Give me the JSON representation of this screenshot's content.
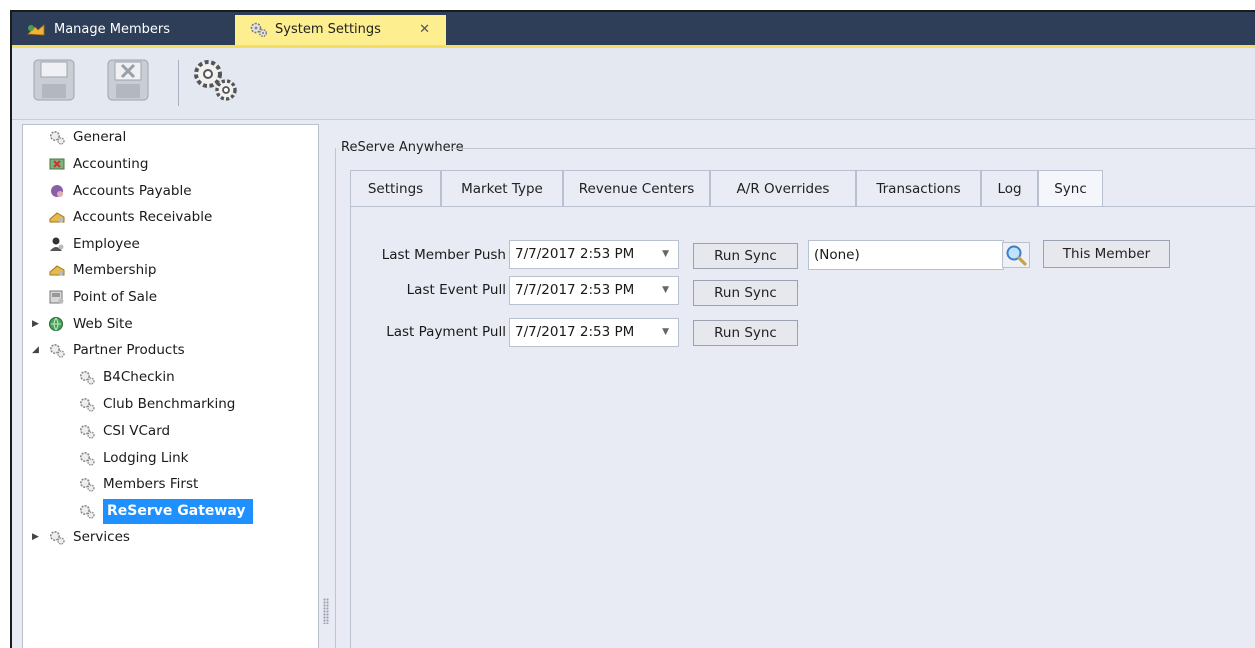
{
  "tabs": [
    {
      "label": "Manage Members",
      "active": false
    },
    {
      "label": "System Settings",
      "active": true,
      "close": "✕"
    }
  ],
  "toolbar": {
    "icons": [
      "save-icon",
      "cancel-save-icon",
      "settings-gears-icon"
    ]
  },
  "tree": {
    "items": [
      {
        "label": "General",
        "icon": "gears-icon",
        "level": 0
      },
      {
        "label": "Accounting",
        "icon": "accounting-icon",
        "level": 0
      },
      {
        "label": "Accounts Payable",
        "icon": "accounts-payable-icon",
        "level": 0
      },
      {
        "label": "Accounts Receivable",
        "icon": "accounts-receivable-icon",
        "level": 0
      },
      {
        "label": "Employee",
        "icon": "employee-icon",
        "level": 0
      },
      {
        "label": "Membership",
        "icon": "membership-icon",
        "level": 0
      },
      {
        "label": "Point of Sale",
        "icon": "pos-icon",
        "level": 0
      },
      {
        "label": "Web Site",
        "icon": "globe-icon",
        "level": 0,
        "expander": "collapsed"
      },
      {
        "label": "Partner Products",
        "icon": "gears-icon",
        "level": 0,
        "expander": "expanded"
      },
      {
        "label": "B4Checkin",
        "icon": "gears-icon",
        "level": 1
      },
      {
        "label": "Club Benchmarking",
        "icon": "gears-icon",
        "level": 1
      },
      {
        "label": "CSI VCard",
        "icon": "gears-icon",
        "level": 1
      },
      {
        "label": "Lodging Link",
        "icon": "gears-icon",
        "level": 1
      },
      {
        "label": "Members First",
        "icon": "gears-icon",
        "level": 1
      },
      {
        "label": "ReServe Gateway",
        "icon": "gears-icon",
        "level": 1,
        "selected": true
      },
      {
        "label": "Services",
        "icon": "gears-icon",
        "level": 0,
        "expander": "collapsed"
      }
    ]
  },
  "panel": {
    "group_title": "ReServe Anywhere",
    "tabs": [
      "Settings",
      "Market Type",
      "Revenue Centers",
      "A/R Overrides",
      "Transactions",
      "Log",
      "Sync"
    ],
    "selected_tab": "Sync",
    "sync": {
      "rows": [
        {
          "label": "Last Member Push",
          "date": "7/7/2017 2:53 PM",
          "button": "Run Sync"
        },
        {
          "label": "Last Event Pull",
          "date": "7/7/2017 2:53 PM",
          "button": "Run Sync"
        },
        {
          "label": "Last Payment Pull",
          "date": "7/7/2017 2:53 PM",
          "button": "Run Sync"
        }
      ],
      "member_value": "(None)",
      "this_member_label": "This Member"
    }
  },
  "colors": {
    "tabstrip": "#2f3e58",
    "active_tab": "#fdee90",
    "selection": "#1e90ff",
    "panel_bg": "#e8ebf4"
  }
}
